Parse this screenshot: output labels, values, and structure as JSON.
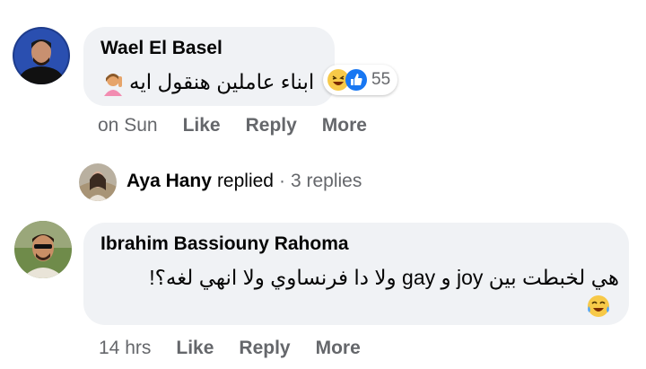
{
  "comments": [
    {
      "author": "Wael El Basel",
      "text": "ابناء عاملين هنقول ايه",
      "reaction_count": "55",
      "reaction_icons": [
        "like-icon",
        "laughing-icon"
      ],
      "timestamp": "on Sun",
      "actions": [
        "Like",
        "Reply",
        "More"
      ]
    },
    {
      "author": "Ibrahim Bassiouny Rahoma",
      "text": "هي لخبطت بين joy و gay ولا دا فرنساوي ولا انهي لغه؟!",
      "timestamp": "14 hrs",
      "actions": [
        "Like",
        "Reply",
        "More"
      ]
    }
  ],
  "replied": {
    "name": "Aya Hany",
    "verb": "replied",
    "count": "3 replies"
  },
  "colors": {
    "bubble": "#f0f2f5",
    "secondary_text": "#65676b",
    "like_blue": "#1877f2",
    "emoji_yellow": "#f7c948"
  }
}
